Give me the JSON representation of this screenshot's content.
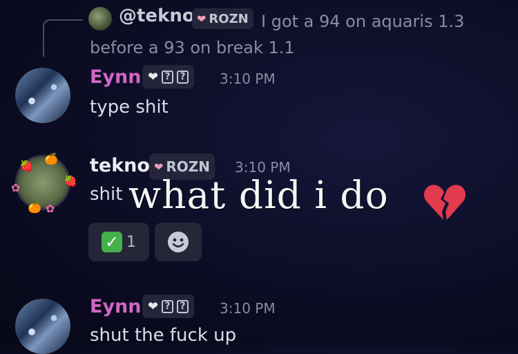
{
  "reply": {
    "username": "@tekno",
    "tag": "ROZN",
    "text": "I got a 94 on aquaris 1.3 before a 93 on break 1.1"
  },
  "messages": [
    {
      "username": "Eynn",
      "badge_boxes": [
        "?",
        "?"
      ],
      "time": "3:10 PM",
      "text": "type shit"
    },
    {
      "username": "tekno",
      "tag": "ROZN",
      "time": "3:10 PM",
      "text": "shit"
    },
    {
      "username": "Eynn",
      "badge_boxes": [
        "?",
        "?"
      ],
      "time": "3:10 PM",
      "text": "shut the fuck up"
    }
  ],
  "reactions": {
    "check_count": "1"
  },
  "overlay": {
    "text": "what did i do"
  },
  "icons": {
    "pink_heart": "pink-heart-icon",
    "white_heart": "white-heart-icon",
    "broken_heart": "broken-heart-icon",
    "check": "check-mark-icon",
    "add_reaction": "add-reaction-icon"
  },
  "colors": {
    "background": "#0c0d24",
    "username_eynn": "#d266c4",
    "timestamp": "#8b8ca4",
    "reaction_bg": "#252637"
  }
}
